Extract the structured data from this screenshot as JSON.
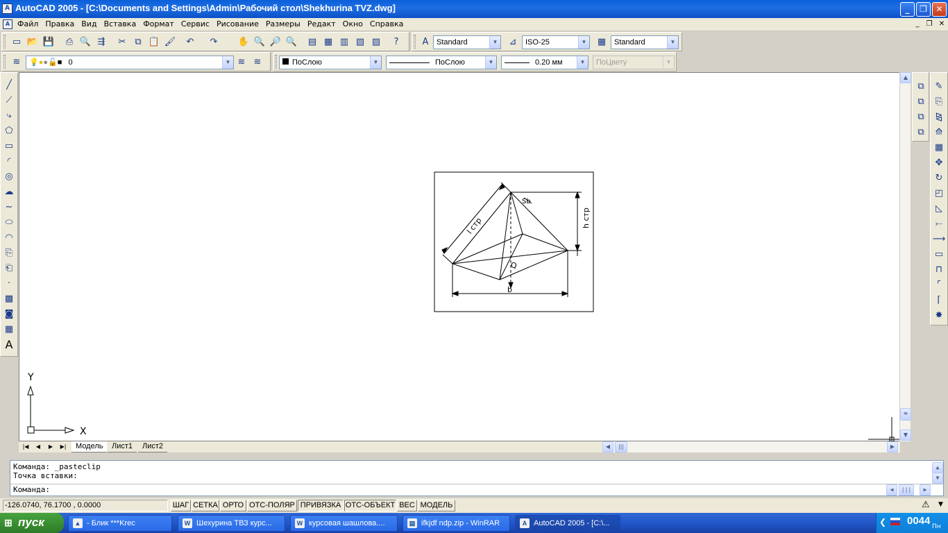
{
  "window": {
    "title": "AutoCAD 2005 - [C:\\Documents and Settings\\Admin\\Рабочий стол\\Shekhurina TVZ.dwg]",
    "minimize": "_",
    "maximize": "❐",
    "close": "✕"
  },
  "menu": {
    "items": [
      "Файл",
      "Правка",
      "Вид",
      "Вставка",
      "Формат",
      "Сервис",
      "Рисование",
      "Размеры",
      "Редакт",
      "Окно",
      "Справка"
    ],
    "doc_min": "_",
    "doc_restore": "❐",
    "doc_close": "✕"
  },
  "styles": {
    "text_style": "Standard",
    "dim_style": "ISO-25",
    "table_style": "Standard"
  },
  "layers": {
    "current_layer": "0",
    "color": "ПоСлою",
    "linetype": "ПоСлою",
    "lineweight": "0.20 мм",
    "plotstyle": "ПоЦвету"
  },
  "drawing": {
    "labels": {
      "l_str": "l стр",
      "sb": "Sb",
      "h_str": "h стр",
      "q": "Q",
      "b": "b"
    },
    "ucs": {
      "x": "X",
      "y": "Y"
    }
  },
  "tabs": [
    "Модель",
    "Лист1",
    "Лист2"
  ],
  "active_tab": "Модель",
  "command": {
    "line1": "Команда: _pasteclip",
    "line2": "Точка вставки:",
    "prompt": "Команда:"
  },
  "status": {
    "coords": "-126.0740, 76.1700 , 0.0000",
    "buttons": [
      "ШАГ",
      "СЕТКА",
      "ОРТО",
      "ОТС-ПОЛЯР",
      "ПРИВЯЗКА",
      "ОТС-ОБЪЕКТ",
      "ВЕС",
      "МОДЕЛЬ"
    ]
  },
  "taskbar": {
    "start": "пуск",
    "tasks": [
      {
        "label": "- Блик ***Krec"
      },
      {
        "label": "Шехурина ТВЗ курс..."
      },
      {
        "label": "курсовая шашлова...."
      },
      {
        "label": "ifkjdf ndp.zip - WinRAR"
      },
      {
        "label": "AutoCAD 2005 - [C:\\..."
      }
    ],
    "clock": "0044",
    "clock_day": "Пн"
  },
  "colors": {
    "titlebar": "#0a5fd8",
    "taskbar": "#2157c8",
    "start": "#3a8f32"
  }
}
